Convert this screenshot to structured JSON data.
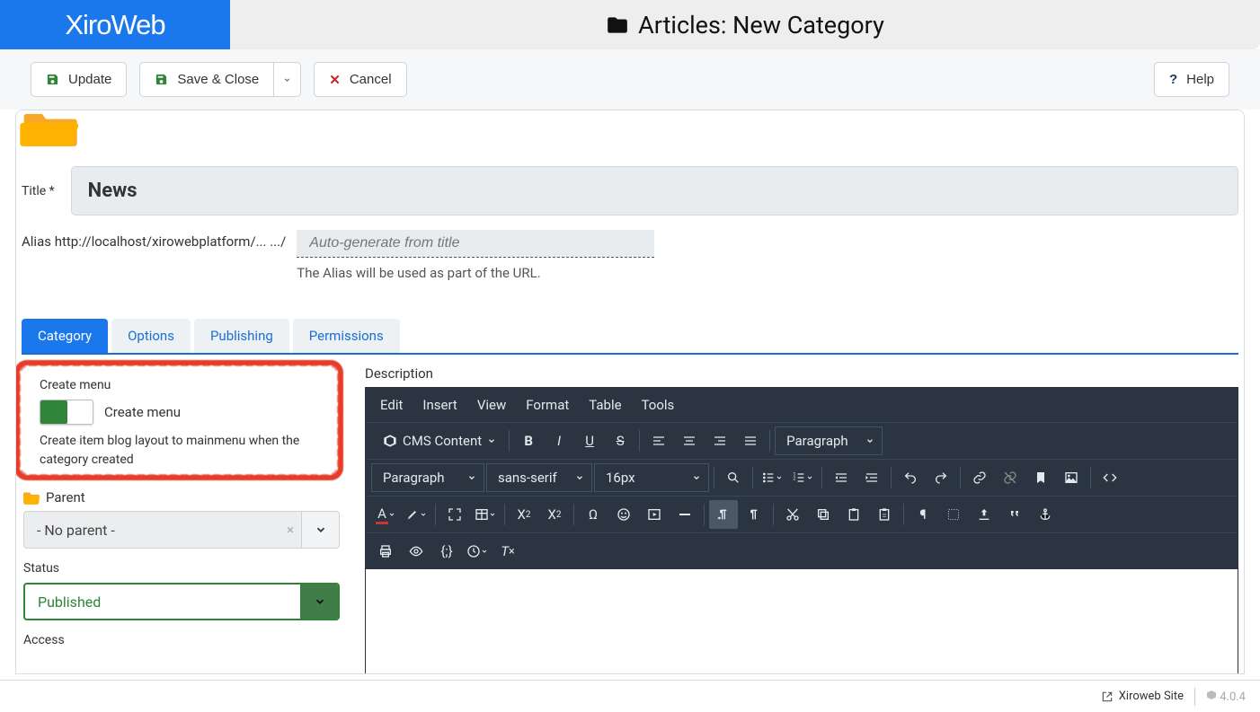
{
  "brand": "XiroWeb",
  "page_title": "Articles: New Category",
  "toolbar": {
    "update": "Update",
    "save_close": "Save & Close",
    "cancel": "Cancel",
    "help": "Help"
  },
  "form": {
    "title_label": "Title *",
    "title_value": "News",
    "alias_label": "Alias http://localhost/xirowebplatform/... .../",
    "alias_placeholder": "Auto-generate from title",
    "alias_hint": "The Alias will be used as part of the URL."
  },
  "tabs": [
    "Category",
    "Options",
    "Publishing",
    "Permissions"
  ],
  "left": {
    "create_menu_label": "Create menu",
    "create_menu_toggle_label": "Create menu",
    "create_menu_desc": "Create item blog layout to mainmenu when the category created",
    "parent_label": "Parent",
    "parent_value": "- No parent -",
    "status_label": "Status",
    "status_value": "Published",
    "access_label": "Access"
  },
  "right": {
    "description_label": "Description"
  },
  "editor": {
    "menus": [
      "Edit",
      "Insert",
      "View",
      "Format",
      "Table",
      "Tools"
    ],
    "cms_content": "CMS Content",
    "block_format": "Paragraph",
    "block_format2": "Paragraph",
    "font_family": "sans-serif",
    "font_size": "16px"
  },
  "footer": {
    "site_link": "Xiroweb Site",
    "version": "4.0.4"
  }
}
